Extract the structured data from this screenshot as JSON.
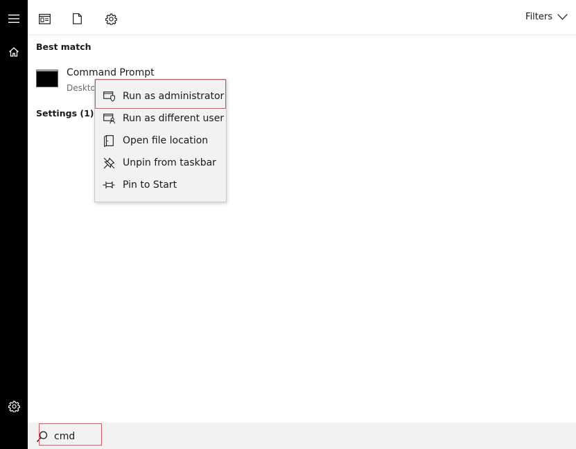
{
  "sidebar": {
    "menu_icon": "hamburger-menu-icon",
    "home_icon": "home-icon",
    "settings_icon": "gear-icon"
  },
  "toolbar": {
    "icons": [
      "app-window-icon",
      "document-icon",
      "gear-icon"
    ],
    "filters_label": "Filters"
  },
  "results": {
    "best_match_label": "Best match",
    "top_result": {
      "title": "Command Prompt",
      "subtitle": "Deskto"
    },
    "settings_label": "Settings (1)"
  },
  "context_menu": {
    "items": [
      {
        "label": "Run as administrator",
        "icon": "run-as-admin-shield-icon"
      },
      {
        "label": "Run as different user",
        "icon": "run-as-user-icon"
      },
      {
        "label": "Open file location",
        "icon": "open-file-location-icon"
      },
      {
        "label": "Unpin from taskbar",
        "icon": "unpin-icon"
      },
      {
        "label": "Pin to Start",
        "icon": "pin-icon"
      }
    ]
  },
  "search": {
    "value": "cmd",
    "icon": "search-icon"
  },
  "colors": {
    "sidebar_bg": "#000000",
    "menu_bg": "#f2f2f2",
    "highlight_border": "#e0555e",
    "search_bg": "#f2f2f2"
  }
}
